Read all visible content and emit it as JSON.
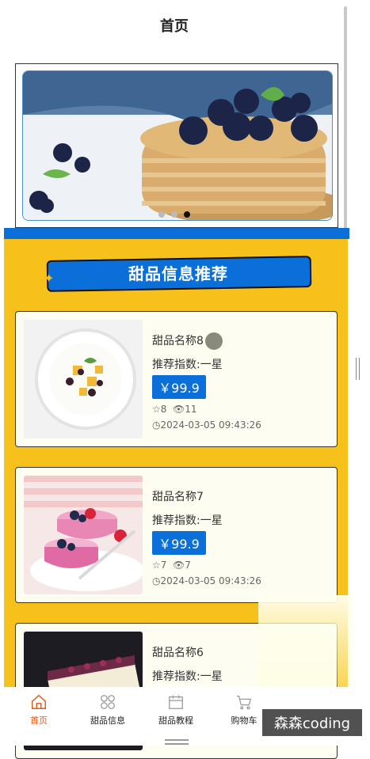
{
  "header": {
    "title": "首页"
  },
  "banner": {
    "dots": 3,
    "active_dot": 2
  },
  "section": {
    "title": "甜品信息推荐"
  },
  "cards": [
    {
      "name": "甜品名称8",
      "recommend": "推荐指数:一星",
      "price": "￥99.9",
      "stars": "8",
      "views": "11",
      "date": "2024-03-05 09:43:26"
    },
    {
      "name": "甜品名称7",
      "recommend": "推荐指数:一星",
      "price": "￥99.9",
      "stars": "7",
      "views": "7",
      "date": "2024-03-05 09:43:26"
    },
    {
      "name": "甜品名称6",
      "recommend": "推荐指数:一星",
      "price": "",
      "stars": "",
      "views": "",
      "date": ""
    }
  ],
  "tabs": [
    {
      "label": "首页",
      "icon": "home-icon",
      "active": true
    },
    {
      "label": "甜品信息",
      "icon": "grid-icon",
      "active": false
    },
    {
      "label": "甜品教程",
      "icon": "calendar-icon",
      "active": false
    },
    {
      "label": "购物车",
      "icon": "cart-icon",
      "active": false
    }
  ],
  "watermark": "森森coding",
  "colors": {
    "accent": "#0a6fd8",
    "section_bg": "#f7c11c",
    "tab_active": "#e65a1e",
    "card_bg": "#fdfdf2"
  }
}
